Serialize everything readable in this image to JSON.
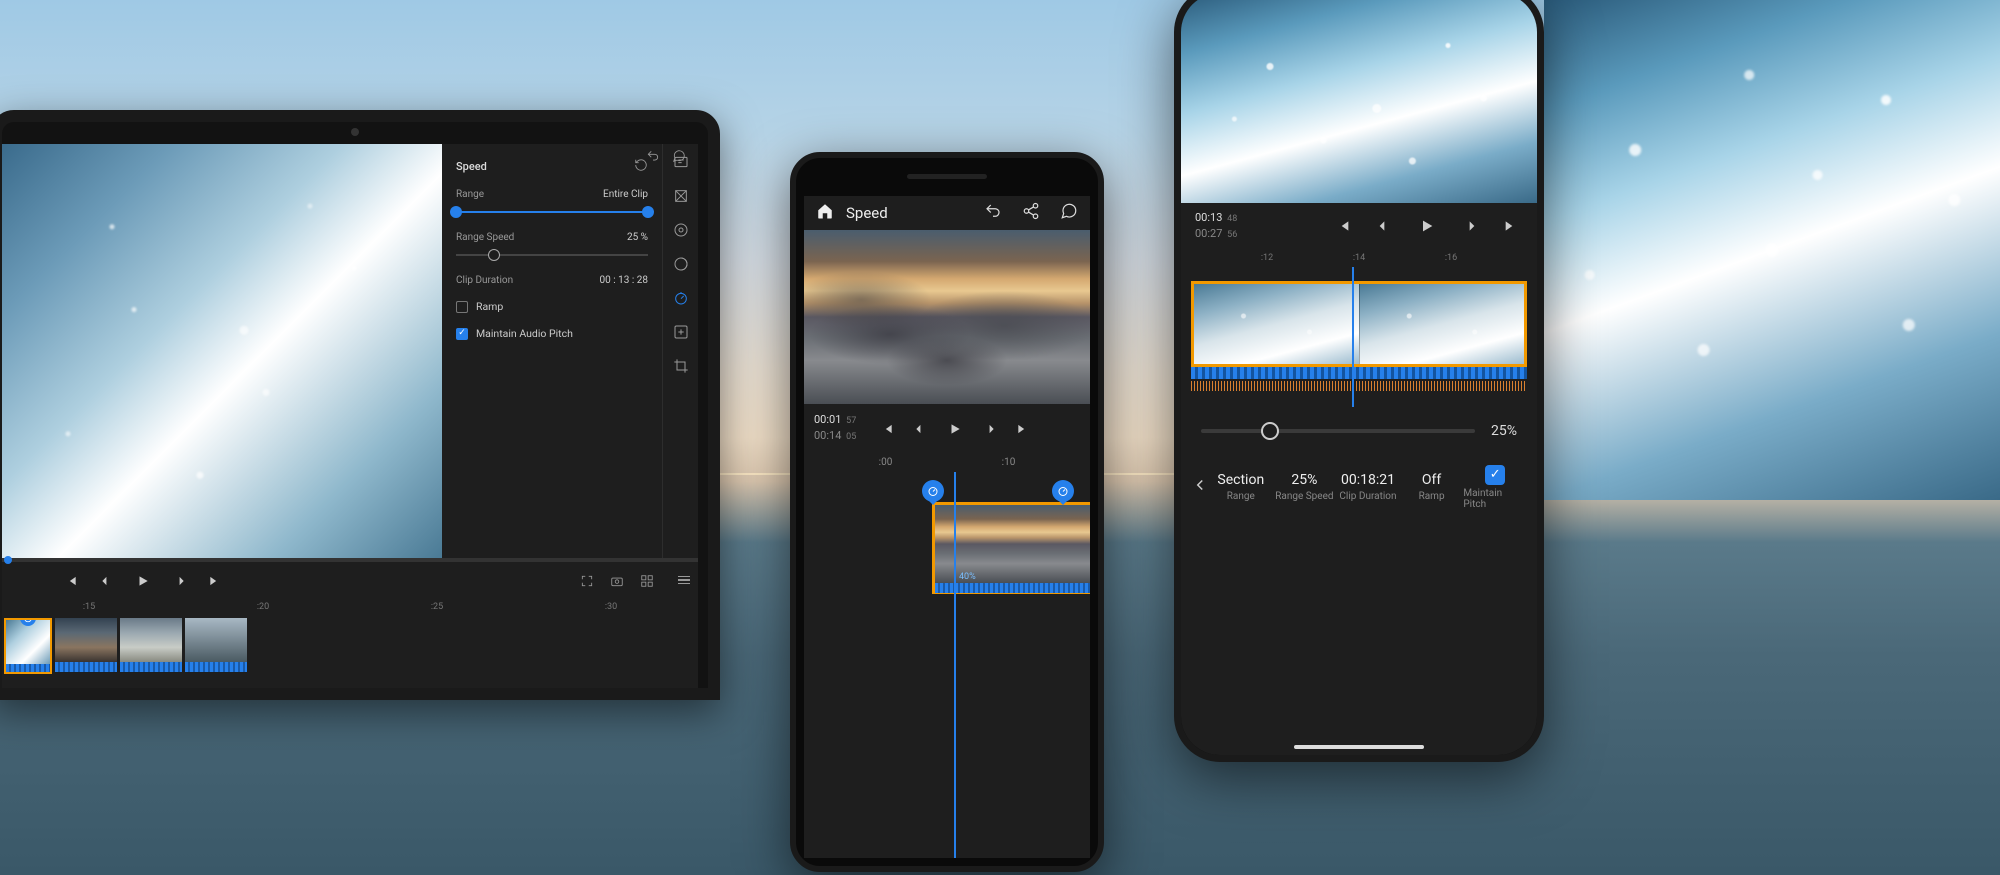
{
  "tablet": {
    "panel": {
      "title": "Speed",
      "range_label": "Range",
      "range_value": "Entire Clip",
      "speed_label": "Range Speed",
      "speed_value": "25 %",
      "duration_label": "Clip Duration",
      "duration_value": "00 : 13 : 28",
      "ramp_label": "Ramp",
      "pitch_label": "Maintain Audio Pitch"
    },
    "ruler": {
      "t1": ":15",
      "t2": ":20",
      "t3": ":25",
      "t4": ":30"
    }
  },
  "android": {
    "title": "Speed",
    "time": {
      "cur": "00:01",
      "cur_f": "57",
      "dur": "00:14",
      "dur_f": "05"
    },
    "ruler": {
      "t1": ":00",
      "t2": ":10"
    },
    "clip_pct": "40%"
  },
  "iphone": {
    "time": {
      "cur": "00:13",
      "cur_f": "48",
      "dur": "00:27",
      "dur_f": "56"
    },
    "ruler": {
      "t1": ":12",
      "t2": ":14",
      "t3": ":16"
    },
    "speed_pct": "25%",
    "opts": {
      "section_v": "Section",
      "section_l": "Range",
      "speed_v": "25%",
      "speed_l": "Range Speed",
      "dur_v": "00:18:21",
      "dur_l": "Clip Duration",
      "ramp_v": "Off",
      "ramp_l": "Ramp",
      "pitch_l": "Maintain Pitch"
    }
  }
}
